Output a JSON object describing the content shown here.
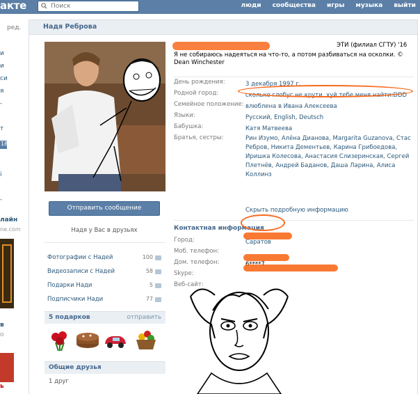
{
  "header": {
    "logo": "акте",
    "search_placeholder": "Поиск",
    "nav": [
      "люди",
      "сообщества",
      "игры",
      "музыка",
      "выйти"
    ]
  },
  "leftbar": {
    "edit_fragment": "ред.",
    "counter_fragment": "18",
    "ad_title_fragment": "лайн",
    "ad_site_fragment": "ne.com",
    "ad2_fragment": "в",
    "ad3_fragment": "ь"
  },
  "profile": {
    "page_title": "Надя Реброва",
    "send_message": "Отправить сообщение",
    "friend_note": "Надя у Вас в друзьях",
    "stats": [
      {
        "label": "Фотографии с Надей",
        "count": "100"
      },
      {
        "label": "Видеозаписи с Надей",
        "count": "58"
      },
      {
        "label": "Подарки Нади",
        "count": "5"
      },
      {
        "label": "Подписчики Нади",
        "count": "77"
      }
    ],
    "gifts_title": "5 подарков",
    "gifts_action": "отправить",
    "mutual_title": "Общие друзья",
    "mutual_count": "1 друг"
  },
  "info": {
    "university": "ЭТИ (филиал СГТУ) '16",
    "status": "Я не собираюсь надеяться на что-то, а потом разбиваться на осколки. © Dean Winchester",
    "rows": [
      {
        "key": "День рождения:",
        "value": "3 декабря 1997 г."
      },
      {
        "key": "Родной город:",
        "value": "сколько глобус не крути, хуй тебе меня найти:DDD"
      },
      {
        "key": "Семейное положение:",
        "value": "влюблена в Ивана Алексеева"
      },
      {
        "key": "Языки:",
        "value": "Русский, English, Deutsch"
      },
      {
        "key": "Бабушка:",
        "value": "Катя Матвеева"
      },
      {
        "key": "Братья, сестры:",
        "value": "Рин Изумо, Алёна Дианова, Margarita Guzanova, Стас Ребров, Никита Дементьев, Карина Грибоедова, Иришка Колесова, Анастасия Слизеринская, Сергей Плетнёв, Андрей Баданов, Даша Ларина, Алиса Коллинз"
      }
    ],
    "show_more": "Скрыть подробную информацию"
  },
  "contact": {
    "title": "Контактная информация",
    "rows": [
      {
        "key": "Город:",
        "value": "Саратов"
      },
      {
        "key": "Моб. телефон:",
        "value": ""
      },
      {
        "key": "Дом. телефон:",
        "value": "6****7"
      },
      {
        "key": "Skype:",
        "value": ""
      },
      {
        "key": "Веб-сайт:",
        "value": ""
      }
    ]
  },
  "colors": {
    "vk_blue": "#5b7fa6",
    "link": "#2b587a",
    "scribble": "#f86a1d"
  }
}
